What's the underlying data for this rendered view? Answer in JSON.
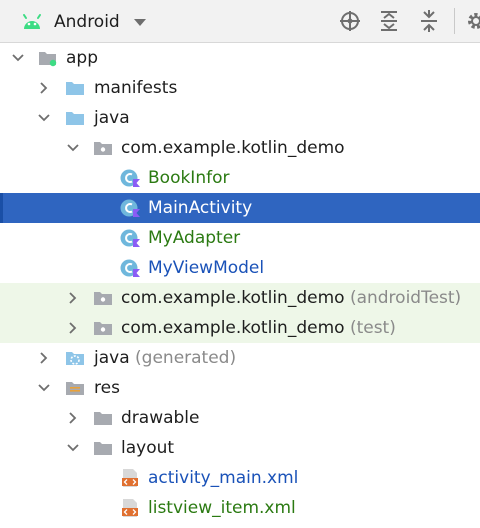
{
  "toolbar": {
    "view_name": "Android",
    "colors": {
      "android": "#3ddc84"
    },
    "buttons": [
      {
        "name": "locate-icon"
      },
      {
        "name": "expand-all-icon"
      },
      {
        "name": "collapse-all-icon"
      },
      {
        "name": "settings-gear-icon"
      }
    ]
  },
  "tree": {
    "app": "app",
    "manifests": "manifests",
    "java": "java",
    "pkg_main": "com.example.kotlin_demo",
    "cls_bookinfor": "BookInfor",
    "cls_mainactivity": "MainActivity",
    "cls_myadapter": "MyAdapter",
    "cls_myviewmodel": "MyViewModel",
    "pkg_android_test": "com.example.kotlin_demo",
    "android_test_suffix": "(androidTest)",
    "pkg_test": "com.example.kotlin_demo",
    "test_suffix": "(test)",
    "java_generated": "java",
    "generated_suffix": "(generated)",
    "res": "res",
    "drawable": "drawable",
    "layout": "layout",
    "layout_activity_main": "activity_main.xml",
    "layout_listview_item": "listview_item.xml"
  },
  "colors": {
    "selection": "#2f65c0",
    "test_row": "#eef7e8",
    "new_file_green": "#2b7a12",
    "modified_blue": "#1a52b8",
    "kotlin_class": "#6fb7dc"
  }
}
